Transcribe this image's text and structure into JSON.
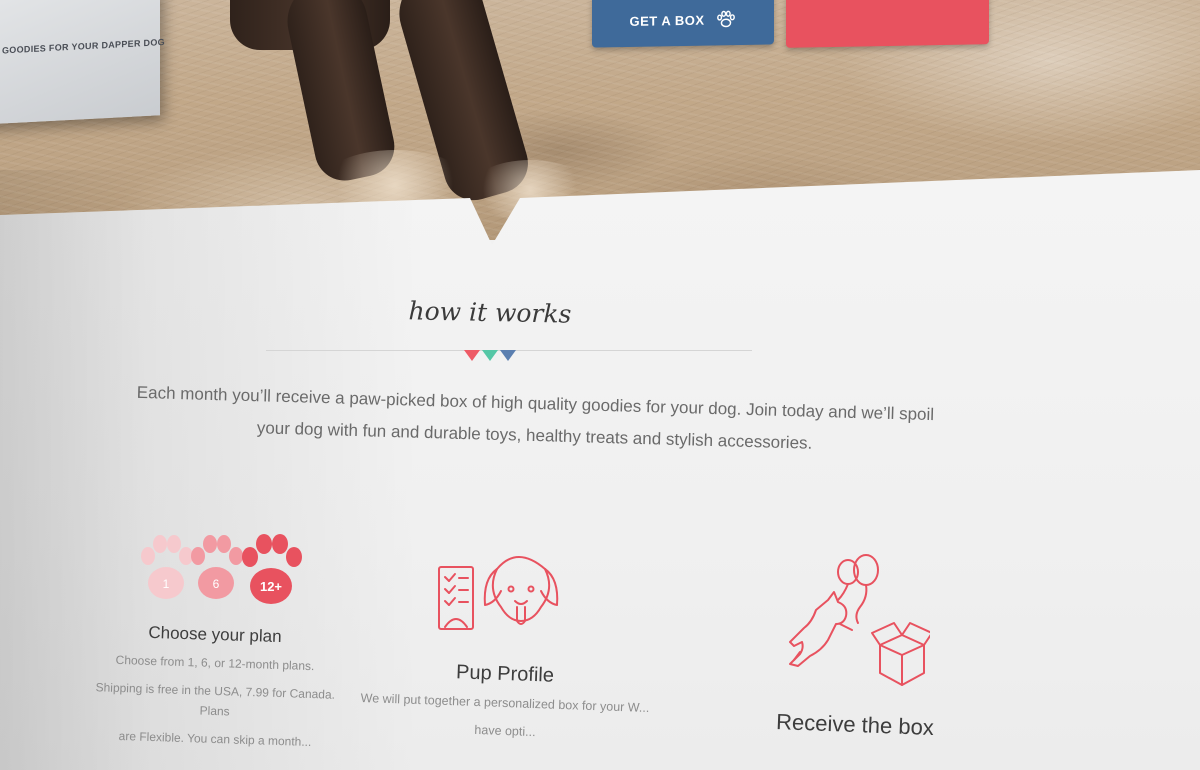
{
  "hero": {
    "box_caption": "GOODIES FOR YOUR DAPPER DOG",
    "cta_primary_label": "GET A BOX",
    "cta_secondary_label": ""
  },
  "how_it_works": {
    "title": "how it works",
    "intro": "Each month you’ll receive a paw-picked box of high quality goodies for your dog. Join today and we’ll spoil your dog with fun and durable toys, healthy treats and stylish accessories.",
    "accent_colors": [
      "#ee5b66",
      "#55c7a6",
      "#5b7fb0"
    ]
  },
  "steps": [
    {
      "title": "Choose your plan",
      "paw_labels": [
        "1",
        "6",
        "12+"
      ],
      "text_lines": [
        "Choose from 1, 6, or 12-month plans.",
        "Shipping is free in the USA, 7.99 for Canada. Plans",
        "are Flexible. You can skip a month..."
      ]
    },
    {
      "title": "Pup Profile",
      "text_lines": [
        "We will put together a personalized box for your W...",
        "have opti..."
      ]
    },
    {
      "title": "Receive the box"
    }
  ],
  "colors": {
    "primary_blue": "#3f6a9a",
    "accent_red": "#e8525f",
    "icon_red": "#e8525f"
  }
}
